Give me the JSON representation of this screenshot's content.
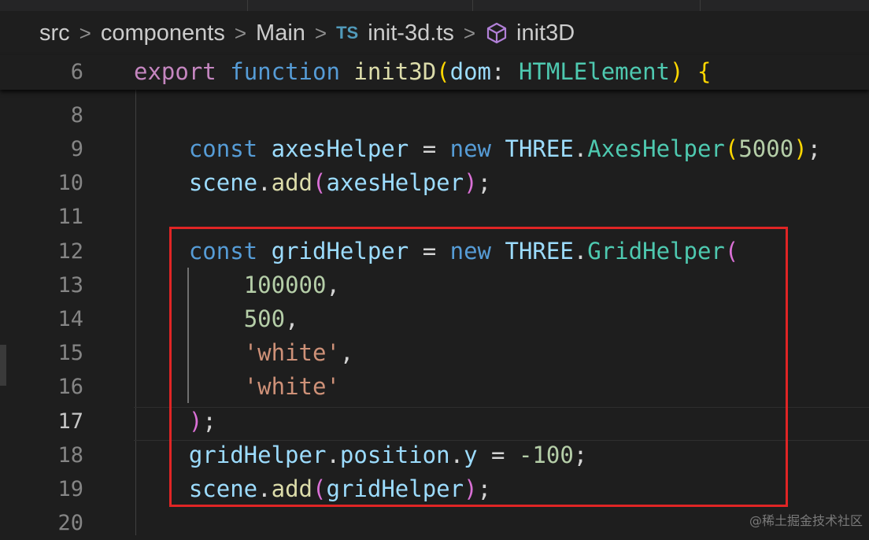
{
  "breadcrumb": {
    "items": [
      "src",
      "components",
      "Main"
    ],
    "file_badge": "TS",
    "file_name": "init-3d.ts",
    "symbol": "init3D",
    "separator": ">"
  },
  "sticky": {
    "line_number": "6",
    "tokens": [
      "export",
      " ",
      "function",
      " ",
      "init3D",
      "(",
      "dom",
      ": ",
      "HTMLElement",
      ")",
      " ",
      "{"
    ]
  },
  "lines": [
    {
      "num": "8",
      "tokens": []
    },
    {
      "num": "9",
      "tokens": [
        "    ",
        "const",
        " ",
        "axesHelper",
        " = ",
        "new",
        " ",
        "THREE",
        ".",
        "AxesHelper",
        "(",
        "5000",
        ")",
        ";"
      ]
    },
    {
      "num": "10",
      "tokens": [
        "    ",
        "scene",
        ".",
        "add",
        "(",
        "axesHelper",
        ")",
        ";"
      ]
    },
    {
      "num": "11",
      "tokens": []
    },
    {
      "num": "12",
      "tokens": [
        "    ",
        "const",
        " ",
        "gridHelper",
        " = ",
        "new",
        " ",
        "THREE",
        ".",
        "GridHelper",
        "("
      ]
    },
    {
      "num": "13",
      "tokens": [
        "        ",
        "100000",
        ","
      ]
    },
    {
      "num": "14",
      "tokens": [
        "        ",
        "500",
        ","
      ]
    },
    {
      "num": "15",
      "tokens": [
        "        ",
        "'white'",
        ","
      ]
    },
    {
      "num": "16",
      "tokens": [
        "        ",
        "'white'"
      ]
    },
    {
      "num": "17",
      "tokens": [
        "    ",
        ")",
        ";"
      ]
    },
    {
      "num": "18",
      "tokens": [
        "    ",
        "gridHelper",
        ".",
        "position",
        ".",
        "y",
        " = ",
        "-100",
        ";"
      ]
    },
    {
      "num": "19",
      "tokens": [
        "    ",
        "scene",
        ".",
        "add",
        "(",
        "gridHelper",
        ")",
        ";"
      ]
    },
    {
      "num": "20",
      "tokens": []
    }
  ],
  "active_line": "17",
  "watermark": "@稀土掘金技术社区",
  "colors": {
    "background": "#1e1e1e",
    "highlight_box": "#e02525",
    "keyword": "#569cd6",
    "string": "#ce9178",
    "number": "#b5cea8"
  }
}
